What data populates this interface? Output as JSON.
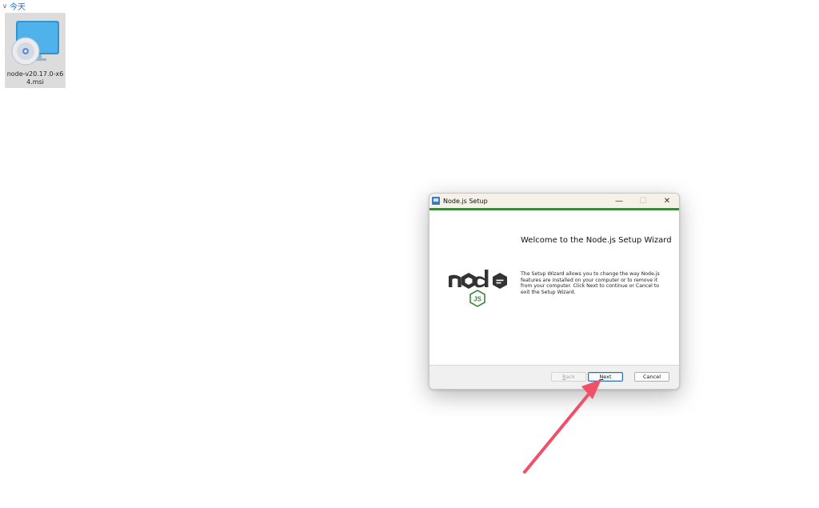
{
  "explorer": {
    "group_label": "今天",
    "file": {
      "name": "node-v20.17.0-x64.msi",
      "icon": "installer-disc-icon"
    }
  },
  "dialog": {
    "title": "Node.js Setup",
    "controls": {
      "minimize": "—",
      "maximize": "☐",
      "close": "✕"
    },
    "heading": "Welcome to the Node.js Setup Wizard",
    "description": "The Setup Wizard allows you to change the way Node.js features are installed on your computer or to remove it from your computer. Click Next to continue or Cancel to exit the Setup Wizard.",
    "logo": {
      "wordmark": "node",
      "badge": "JS"
    },
    "buttons": {
      "back": {
        "accel": "B",
        "rest": "ack",
        "enabled": false
      },
      "next": {
        "accel": "N",
        "rest": "ext",
        "enabled": true
      },
      "cancel": {
        "label": "Cancel",
        "enabled": true
      }
    },
    "accent_color": "#3c873a"
  },
  "annotation": {
    "type": "arrow",
    "color": "#f0506a",
    "points_to": "next-button"
  }
}
